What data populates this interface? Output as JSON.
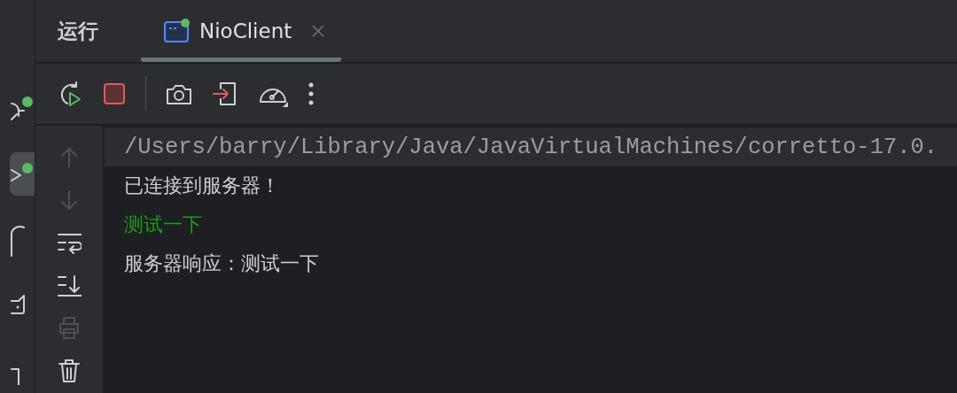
{
  "panel": {
    "title": "运行"
  },
  "tabs": [
    {
      "label": "NioClient",
      "selected": true,
      "running": true
    }
  ],
  "side_tools": [
    {
      "kind": "up",
      "disabled": true
    },
    {
      "kind": "down",
      "disabled": true
    },
    {
      "kind": "wrap",
      "disabled": false
    },
    {
      "kind": "scroll-end",
      "disabled": false
    },
    {
      "kind": "print",
      "disabled": true
    },
    {
      "kind": "trash",
      "disabled": false
    }
  ],
  "console": [
    {
      "kind": "command",
      "text": "/Users/barry/Library/Java/JavaVirtualMachines/corretto-17.0."
    },
    {
      "kind": "output",
      "text": "已连接到服务器！"
    },
    {
      "kind": "input",
      "text": "测试一下"
    },
    {
      "kind": "output",
      "text": "服务器响应：测试一下"
    }
  ]
}
